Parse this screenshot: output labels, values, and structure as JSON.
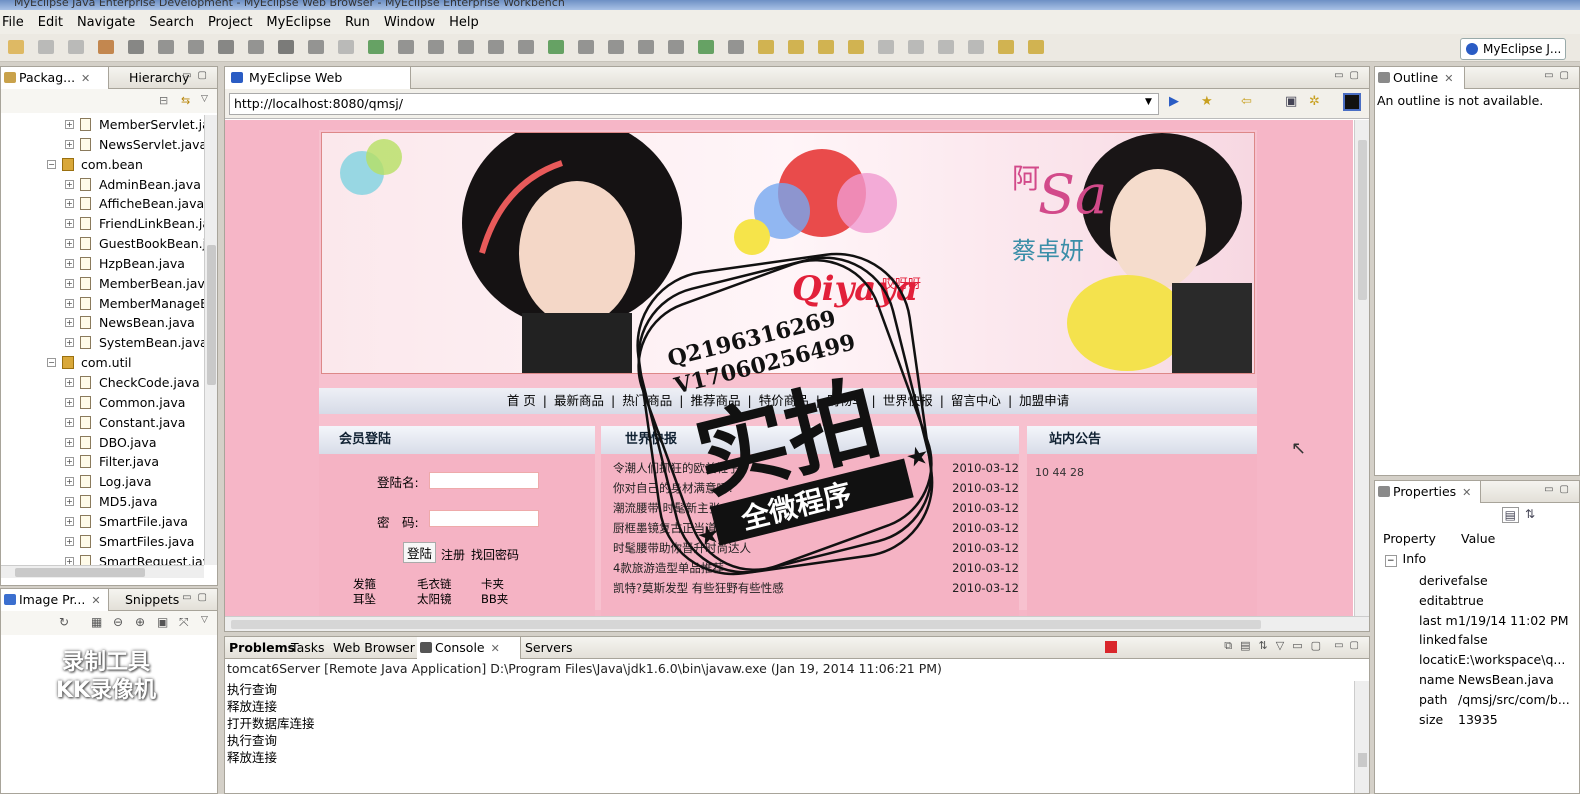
{
  "window_title": "MyEclipse Java Enterprise Development - MyEclipse Web Browser - MyEclipse Enterprise Workbench",
  "menu": [
    "File",
    "Edit",
    "Navigate",
    "Search",
    "Project",
    "MyEclipse",
    "Run",
    "Window",
    "Help"
  ],
  "perspective": "MyEclipse J...",
  "package_explorer": {
    "tabs": [
      "Packag...",
      "Hierarchy"
    ],
    "tree": [
      {
        "label": "MemberServlet.ja",
        "kind": "file",
        "indent": 3
      },
      {
        "label": "NewsServlet.java",
        "kind": "file",
        "indent": 3
      },
      {
        "label": "com.bean",
        "kind": "package",
        "indent": 2
      },
      {
        "label": "AdminBean.java",
        "kind": "file",
        "indent": 3
      },
      {
        "label": "AfficheBean.java",
        "kind": "file",
        "indent": 3
      },
      {
        "label": "FriendLinkBean.ja",
        "kind": "file",
        "indent": 3
      },
      {
        "label": "GuestBookBean.j",
        "kind": "file",
        "indent": 3
      },
      {
        "label": "HzpBean.java",
        "kind": "file",
        "indent": 3
      },
      {
        "label": "MemberBean.java",
        "kind": "file",
        "indent": 3
      },
      {
        "label": "MemberManageE",
        "kind": "file",
        "indent": 3
      },
      {
        "label": "NewsBean.java",
        "kind": "file",
        "indent": 3
      },
      {
        "label": "SystemBean.java",
        "kind": "file",
        "indent": 3
      },
      {
        "label": "com.util",
        "kind": "package",
        "indent": 2
      },
      {
        "label": "CheckCode.java",
        "kind": "file",
        "indent": 3
      },
      {
        "label": "Common.java",
        "kind": "file",
        "indent": 3
      },
      {
        "label": "Constant.java",
        "kind": "file",
        "indent": 3
      },
      {
        "label": "DBO.java",
        "kind": "file",
        "indent": 3
      },
      {
        "label": "Filter.java",
        "kind": "file",
        "indent": 3
      },
      {
        "label": "Log.java",
        "kind": "file",
        "indent": 3
      },
      {
        "label": "MD5.java",
        "kind": "file",
        "indent": 3
      },
      {
        "label": "SmartFile.java",
        "kind": "file",
        "indent": 3
      },
      {
        "label": "SmartFiles.java",
        "kind": "file",
        "indent": 3
      },
      {
        "label": "SmartRequest.jav",
        "kind": "file",
        "indent": 3
      }
    ]
  },
  "image_preview": {
    "tabs": [
      "Image Pr...",
      "Snippets"
    ],
    "watermark": "录制工具\nKK录像机"
  },
  "browser": {
    "tab": "MyEclipse Web Browser",
    "url": "http://localhost:8080/qmsj/",
    "banner": {
      "name_cn": "蔡卓妍",
      "name_prefix": "阿",
      "script": "Sa",
      "logo": "Qiyaya",
      "logo_cn": "哎呀呀"
    },
    "nav": [
      "首 页",
      "最新商品",
      "热门商品",
      "推荐商品",
      "特价商品",
      "购物车",
      "世界快报",
      "留言中心",
      "加盟申请"
    ],
    "login": {
      "title": "会员登陆",
      "user_label": "登陆名:",
      "pass_label": "密　码:",
      "login_btn": "登陆",
      "register": "注册",
      "forgot": "找回密码",
      "cats": [
        [
          "发箍",
          "毛衣链",
          "卡夹"
        ],
        [
          "耳坠",
          "太阳镜",
          "BB夹"
        ]
      ]
    },
    "news": {
      "title": "世界快报",
      "items": [
        {
          "t": "令潮人们抓狂的欧美鞋子",
          "d": "2010-03-12"
        },
        {
          "t": "你对自己的身材满意吗?",
          "d": "2010-03-12"
        },
        {
          "t": "潮流腰带 时髦新主张",
          "d": "2010-03-12"
        },
        {
          "t": "厨框墨镜复古正当道",
          "d": "2010-03-12"
        },
        {
          "t": "时髦腰带助你晋升时尚达人",
          "d": "2010-03-12"
        },
        {
          "t": "4款旅游造型单品推荐",
          "d": "2010-03-12"
        },
        {
          "t": "凯特?莫斯发型 有些狂野有些性感",
          "d": "2010-03-12"
        }
      ]
    },
    "notice": {
      "title": "站内公告",
      "text": "10 44 28"
    }
  },
  "stamp": {
    "line1": "Q2196316269",
    "line2": "V17060256499",
    "big": "实拍",
    "ribbon": "全微程序"
  },
  "console": {
    "tabs": [
      "Problems",
      "Tasks",
      "Web Browser",
      "Console",
      "Servers"
    ],
    "info": "tomcat6Server [Remote Java Application] D:\\Program Files\\Java\\jdk1.6.0\\bin\\javaw.exe (Jan 19, 2014 11:06:21 PM)",
    "lines": [
      "执行查询",
      "释放连接",
      "打开数据库连接",
      "执行查询",
      "释放连接"
    ]
  },
  "outline": {
    "tab": "Outline",
    "message": "An outline is not available."
  },
  "properties": {
    "tab": "Properties",
    "headers": [
      "Property",
      "Value"
    ],
    "group": "Info",
    "rows": [
      {
        "k": "derive",
        "v": "false"
      },
      {
        "k": "editab",
        "v": "true"
      },
      {
        "k": "last m",
        "v": "1/19/14 11:02 PM"
      },
      {
        "k": "linked",
        "v": "false"
      },
      {
        "k": "locatic",
        "v": "E:\\workspace\\q..."
      },
      {
        "k": "name",
        "v": "NewsBean.java"
      },
      {
        "k": "path",
        "v": "/qmsj/src/com/b..."
      },
      {
        "k": "size",
        "v": "13935"
      }
    ]
  },
  "colors": {
    "accent": "#2a5cc4",
    "pink": "#f6b6c7",
    "stop": "#d9262b"
  }
}
